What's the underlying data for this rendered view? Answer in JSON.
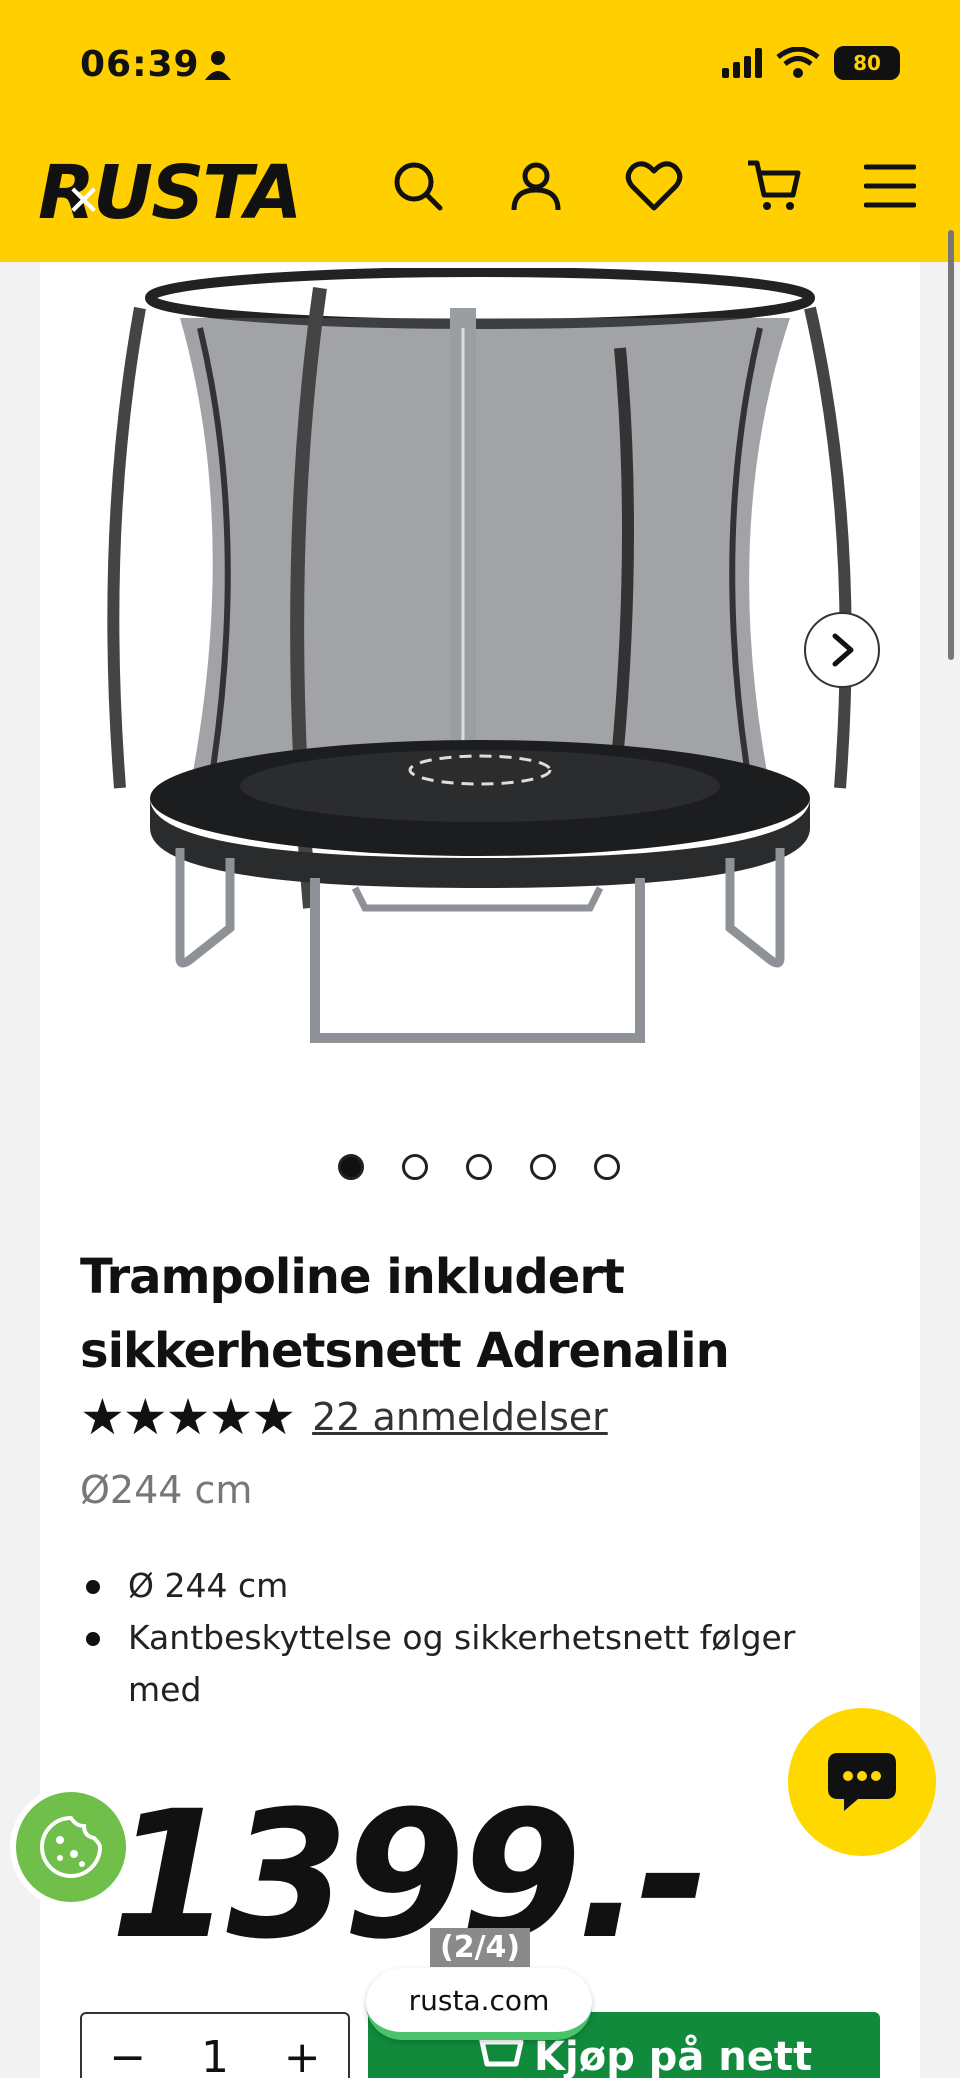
{
  "status_bar": {
    "time": "06:39",
    "battery": "80"
  },
  "header": {
    "logo": "RUSTA"
  },
  "gallery": {
    "current_index": 1,
    "total_dots": 5
  },
  "product": {
    "title": "Trampoline inkludert sikkerhetsnett Adrenalin",
    "rating": 5,
    "stars": "★★★★★",
    "reviews_label": "22 anmeldelser",
    "subtitle": "Ø244 cm",
    "features": [
      "Ø 244 cm",
      "Kantbeskyttelse og sikkerhetsnett følger med"
    ],
    "price": "1399.-"
  },
  "purchase": {
    "qty_minus": "−",
    "qty_value": "1",
    "qty_plus": "+",
    "buy_label": "Kjøp på nett"
  },
  "browser": {
    "tab_counter": "(2/4)",
    "url": "rusta.com"
  },
  "colors": {
    "brand_yellow": "#ffcf00",
    "buy_green": "#118a3c",
    "cookie_green": "#6fbf4a"
  }
}
